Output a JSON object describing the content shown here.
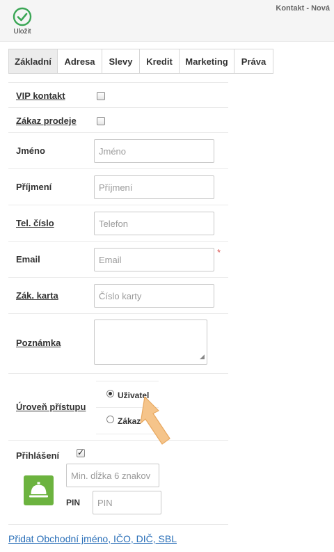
{
  "toolbar": {
    "save_label": "Uložit",
    "title": "Kontakt - Nová"
  },
  "tabs": [
    {
      "label": "Základní"
    },
    {
      "label": "Adresa"
    },
    {
      "label": "Slevy"
    },
    {
      "label": "Kredit"
    },
    {
      "label": "Marketing"
    },
    {
      "label": "Práva"
    }
  ],
  "form": {
    "vip": {
      "label": "VIP kontakt",
      "checked": false
    },
    "sale_ban": {
      "label": "Zákaz prodeje",
      "checked": false
    },
    "first_name": {
      "label": "Jméno",
      "placeholder": "Jméno",
      "value": ""
    },
    "last_name": {
      "label": "Příjmení",
      "placeholder": "Příjmení",
      "value": ""
    },
    "phone": {
      "label": "Tel. číslo",
      "placeholder": "Telefon",
      "value": ""
    },
    "email": {
      "label": "Email",
      "placeholder": "Email",
      "value": "",
      "required_mark": "*"
    },
    "card": {
      "label": "Zák. karta",
      "placeholder": "Číslo karty",
      "value": ""
    },
    "note": {
      "label": "Poznámka",
      "value": ""
    },
    "access_level": {
      "label": "Úroveň přístupu",
      "options": [
        {
          "label": "Uživatel",
          "selected": true
        },
        {
          "label": "Zákaz",
          "selected": false
        }
      ]
    },
    "login": {
      "label": "Přihlášení",
      "checked": true,
      "password_placeholder": "Min. dĺžka 6 znakov",
      "pin_label": "PIN",
      "pin_placeholder": "PIN"
    }
  },
  "footer": {
    "link": "Přidat Obchodní jméno, IČO, DIČ, SBL"
  },
  "colors": {
    "accent_green": "#6cb33f",
    "save_green": "#3aa655",
    "link_blue": "#2a6fb8",
    "arrow_orange": "#f5c48a"
  },
  "icons": {
    "save": "check-circle-icon",
    "login": "bell-icon",
    "pointer": "arrow-icon"
  }
}
